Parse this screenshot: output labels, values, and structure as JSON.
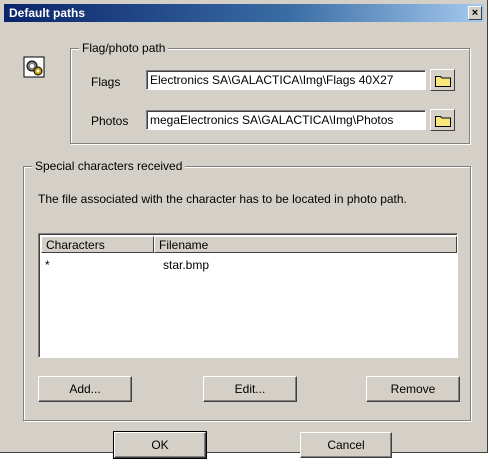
{
  "window": {
    "title": "Default paths",
    "close_label": "×"
  },
  "flag_group": {
    "title": "Flag/photo path",
    "flags_label": "Flags",
    "flags_value": "Electronics SA\\GALACTICA\\Img\\Flags 40X27",
    "photos_label": "Photos",
    "photos_value": "megaElectronics SA\\GALACTICA\\Img\\Photos"
  },
  "special_group": {
    "title": "Special characters received",
    "description": "The file associated with the character has to be located in photo path.",
    "columns": [
      "Characters",
      "Filename"
    ],
    "rows": [
      {
        "character": "*",
        "filename": "star.bmp"
      }
    ],
    "add_label": "Add...",
    "edit_label": "Edit...",
    "remove_label": "Remove"
  },
  "footer": {
    "ok_label": "OK",
    "cancel_label": "Cancel"
  },
  "icons": {
    "app": "gears-icon",
    "folder": "folder-icon",
    "close": "close-icon"
  },
  "colors": {
    "titlebar_start": "#0a246a",
    "titlebar_end": "#a6caf0",
    "face": "#d4d0c8"
  }
}
